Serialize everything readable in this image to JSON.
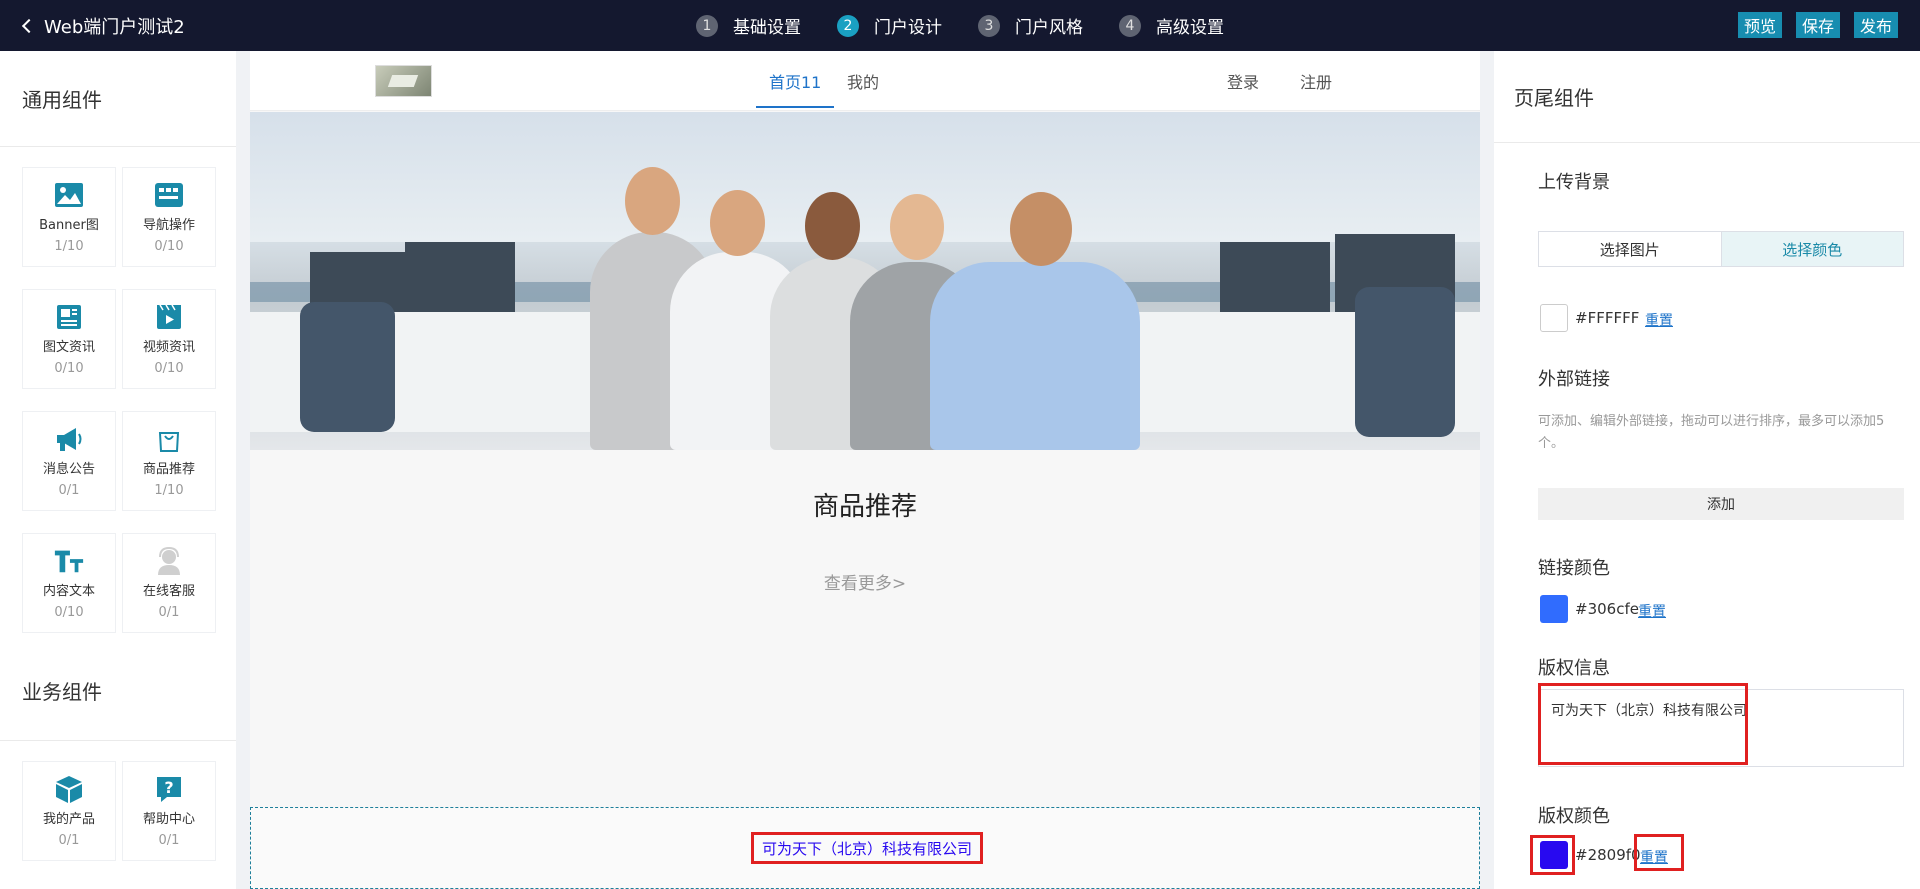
{
  "topbar": {
    "back_label": "Web端门户测试2",
    "steps": [
      {
        "num": "1",
        "label": "基础设置"
      },
      {
        "num": "2",
        "label": "门户设计"
      },
      {
        "num": "3",
        "label": "门户风格"
      },
      {
        "num": "4",
        "label": "高级设置"
      }
    ],
    "actions": {
      "preview": "预览",
      "save": "保存",
      "publish": "发布"
    }
  },
  "left": {
    "general_title": "通用组件",
    "components": [
      {
        "label": "Banner图",
        "count": "1/10",
        "icon": "image-icon"
      },
      {
        "label": "导航操作",
        "count": "0/10",
        "icon": "nav-grid-icon"
      },
      {
        "label": "图文资讯",
        "count": "0/10",
        "icon": "article-icon"
      },
      {
        "label": "视频资讯",
        "count": "0/10",
        "icon": "video-icon"
      },
      {
        "label": "消息公告",
        "count": "0/1",
        "icon": "megaphone-icon"
      },
      {
        "label": "商品推荐",
        "count": "1/10",
        "icon": "shopping-bag-icon"
      },
      {
        "label": "内容文本",
        "count": "0/10",
        "icon": "text-icon"
      },
      {
        "label": "在线客服",
        "count": "0/1",
        "icon": "customer-service-icon"
      }
    ],
    "business_title": "业务组件",
    "business_components": [
      {
        "label": "我的产品",
        "count": "0/1",
        "icon": "cube-icon"
      },
      {
        "label": "帮助中心",
        "count": "0/1",
        "icon": "help-icon"
      }
    ]
  },
  "canvas": {
    "nav": {
      "home": "首页11",
      "mine": "我的",
      "login": "登录",
      "register": "注册"
    },
    "section_heading": "商品推荐",
    "more": "查看更多>",
    "footer_text": "可为天下（北京）科技有限公司"
  },
  "right": {
    "title": "页尾组件",
    "upload_bg_label": "上传背景",
    "choose_image": "选择图片",
    "choose_color": "选择颜色",
    "bg_color_value": "#FFFFFF",
    "reset": "重置",
    "external_links_label": "外部链接",
    "external_links_hint": "可添加、编辑外部链接，拖动可以进行排序，最多可以添加5个。",
    "add": "添加",
    "link_color_label": "链接颜色",
    "link_color_value": "#306cfe",
    "copyright_label": "版权信息",
    "copyright_value": "可为天下（北京）科技有限公司",
    "copyright_color_label": "版权颜色",
    "copyright_color_value": "#2809f0"
  },
  "colors": {
    "topbar_bg": "#14182f",
    "accent": "#178db0",
    "highlight": "#e02020",
    "link_color": "#306cfe",
    "copyright_color": "#2809f0"
  }
}
